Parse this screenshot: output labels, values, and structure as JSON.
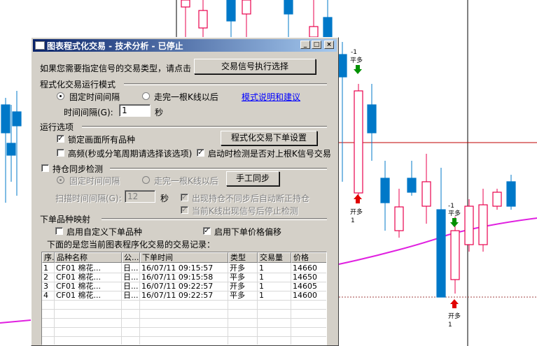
{
  "window": {
    "title": "图表程式化交易 - 技术分析 - 已停止",
    "buttons": {
      "minimize": "_",
      "maximize": "□",
      "close": "×"
    }
  },
  "signal": {
    "prompt": "如果您需要指定信号的交易类型，请点击",
    "button": "交易信号执行选择"
  },
  "run_mode": {
    "group_label": "程式化交易运行模式",
    "fixed_interval": "固定时间间隔",
    "after_bar": "走完一根K线以后",
    "help_link": "模式说明和建议",
    "interval_label": "时间间隔(G):",
    "interval_value": "1",
    "interval_unit": "秒"
  },
  "options": {
    "group_label": "运行选项",
    "lock_chart": "锁定画面所有品种",
    "order_settings_button": "程式化交易下单设置",
    "high_freq": "高频(秒或分笔周期请选择该选项)",
    "check_on_start": "启动时检测是否对上根K信号交易"
  },
  "sync": {
    "group_label": "持仓同步检测",
    "fixed_interval": "固定时间间隔",
    "after_bar": "走完一根K线以后",
    "manual_sync_button": "手工同步",
    "scan_label": "扫描时间间隔(G):",
    "scan_value": "12",
    "scan_unit": "秒",
    "auto_sync": "出现持仓不同步后自动断正持仓",
    "stop_check": "当前K线出现信号后停止检测"
  },
  "mapping": {
    "group_label": "下单品种映射",
    "custom_symbol": "启用自定义下单品种",
    "price_offset": "启用下单价格偏移",
    "records_caption": "下面的是您当前图表程序化交易的交易记录："
  },
  "records": {
    "headers": [
      "序.",
      "品种名称",
      "公...",
      "下单时间",
      "类型",
      "交易量",
      "价格"
    ],
    "rows": [
      [
        "1",
        "CF01 棉花...",
        "日...",
        "16/07/11 09:15:57",
        "开多",
        "1",
        "14660"
      ],
      [
        "2",
        "CF01 棉花...",
        "日...",
        "16/07/11 09:15:58",
        "平多",
        "1",
        "14650"
      ],
      [
        "3",
        "CF01 棉花...",
        "日...",
        "16/07/11 09:22:57",
        "开多",
        "1",
        "14605"
      ],
      [
        "4",
        "CF01 棉花...",
        "日...",
        "16/07/11 09:22:57",
        "平多",
        "1",
        "14600"
      ]
    ]
  },
  "chart_labels": {
    "m1_top": "-1",
    "close_long_1": "平多",
    "open_long_1": "开多",
    "one_1": "1",
    "m1_b": "-1",
    "close_long_2": "平多",
    "open_long_2": "开多",
    "one_2": "1"
  },
  "colors": {
    "up": "#e8004c",
    "down": "#0078c8",
    "ma": "#e020e0",
    "hline": "#c00000"
  }
}
